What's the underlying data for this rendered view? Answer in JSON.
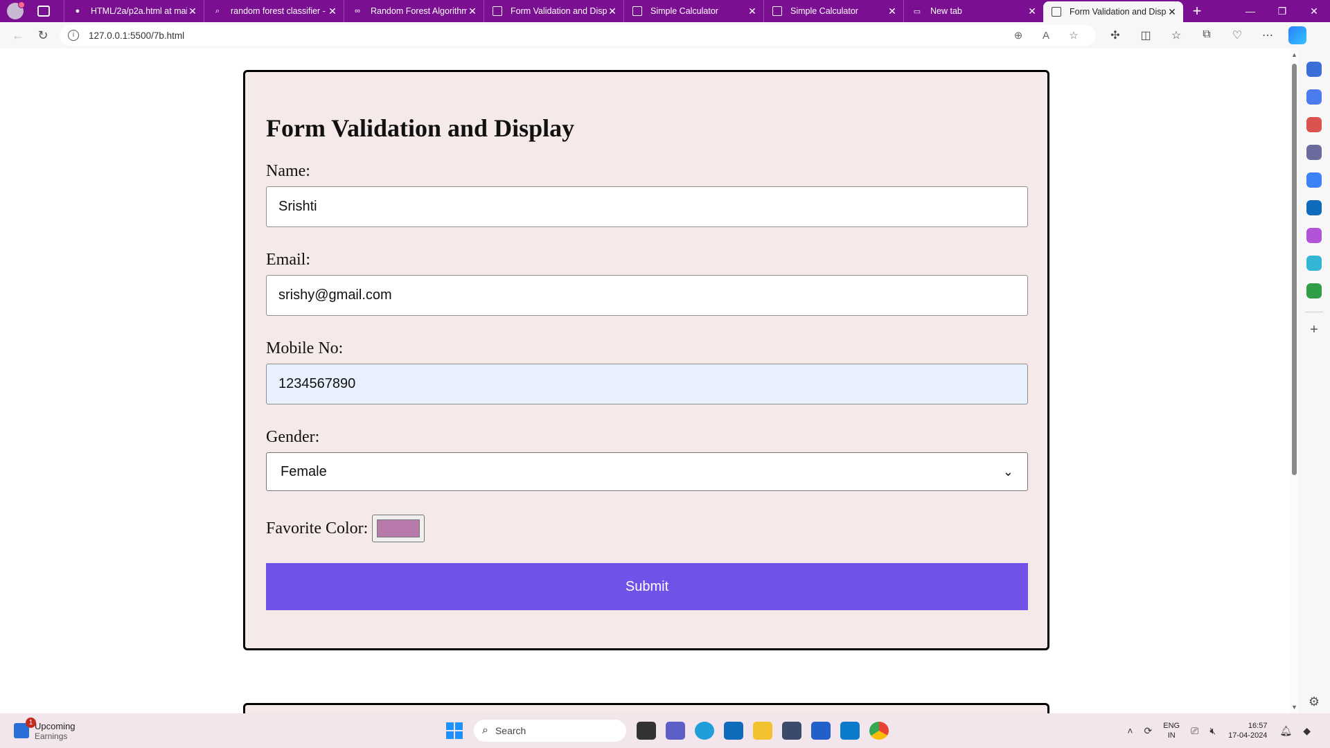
{
  "browser": {
    "tabs": [
      {
        "title": "HTML/2a/p2a.html at mai",
        "icon": "github-icon"
      },
      {
        "title": "random forest classifier -",
        "icon": "search-icon"
      },
      {
        "title": "Random Forest Algorithm",
        "icon": "gfg-icon"
      },
      {
        "title": "Form Validation and Displ",
        "icon": "page-icon"
      },
      {
        "title": "Simple Calculator",
        "icon": "page-icon"
      },
      {
        "title": "Simple Calculator",
        "icon": "page-icon"
      },
      {
        "title": "New tab",
        "icon": "newtab-icon"
      },
      {
        "title": "Form Validation and Displ",
        "icon": "page-icon",
        "active": true
      }
    ],
    "address": "127.0.0.1:5500/7b.html"
  },
  "form": {
    "heading": "Form Validation and Display",
    "name_label": "Name:",
    "name_value": "Srishti",
    "email_label": "Email:",
    "email_value": "srishy@gmail.com",
    "mobile_label": "Mobile No:",
    "mobile_value": "1234567890",
    "gender_label": "Gender:",
    "gender_value": "Female",
    "color_label": "Favorite Color:",
    "color_value": "#b77aab",
    "submit_label": "Submit",
    "submit_color": "#7052e8"
  },
  "taskbar": {
    "weather_title": "Upcoming",
    "weather_sub": "Earnings",
    "weather_badge": "1",
    "search_placeholder": "Search",
    "lang_line1": "ENG",
    "lang_line2": "IN",
    "time": "16:57",
    "date": "17-04-2024"
  }
}
